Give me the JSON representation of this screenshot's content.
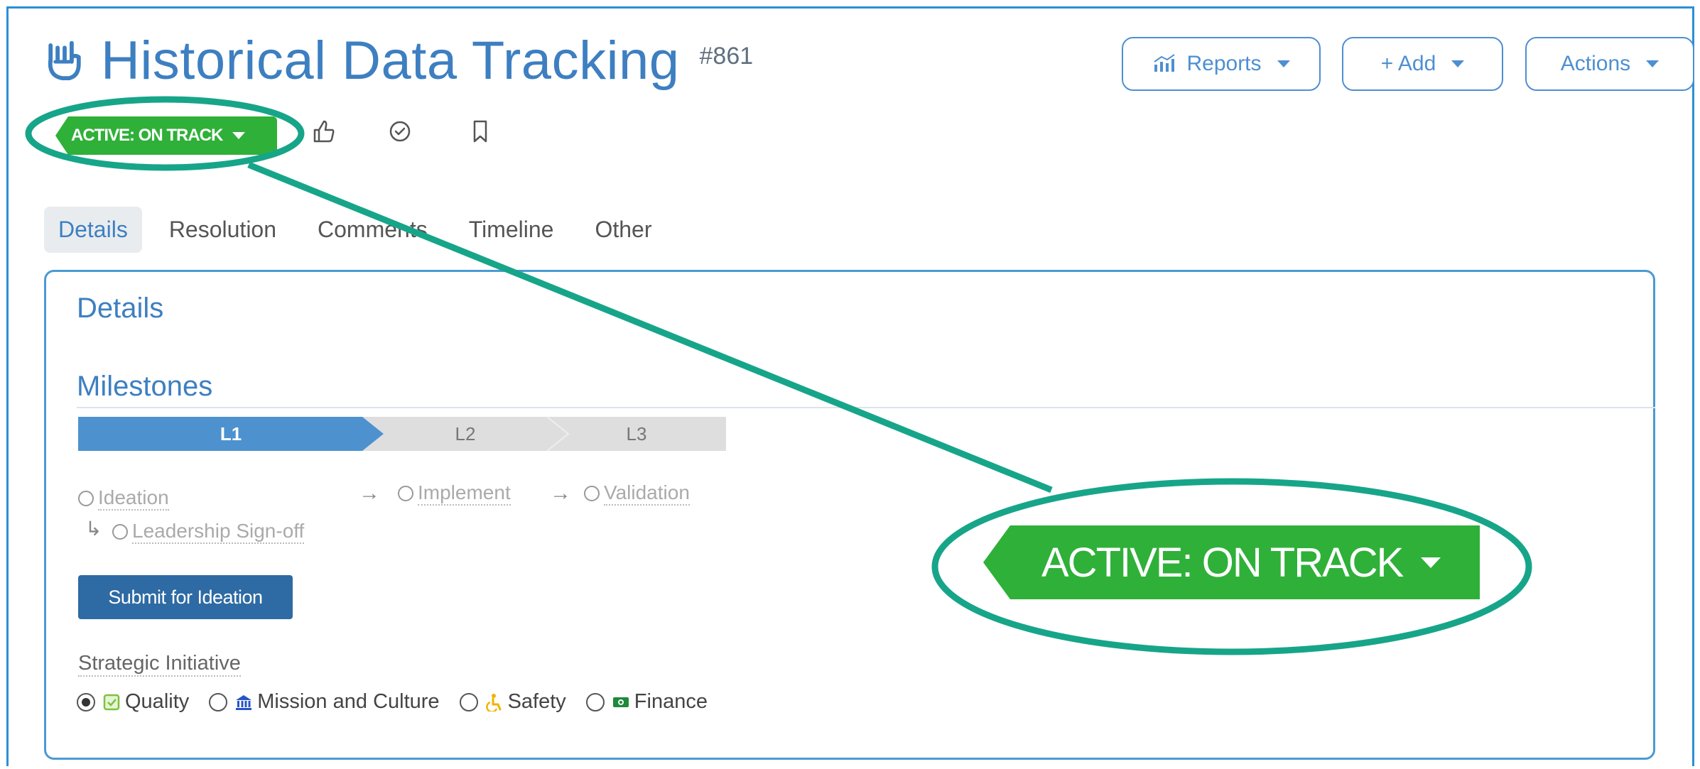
{
  "header": {
    "title": "Historical Data Tracking",
    "id": "#861",
    "buttons": {
      "reports": "Reports",
      "add": "+ Add",
      "actions": "Actions"
    }
  },
  "status": {
    "label": "ACTIVE: ON TRACK",
    "color": "#2fb039"
  },
  "tabs": [
    "Details",
    "Resolution",
    "Comments",
    "Timeline",
    "Other"
  ],
  "panel": {
    "title": "Details",
    "milestones": {
      "title": "Milestones",
      "steps": [
        "L1",
        "L2",
        "L3"
      ],
      "stages": {
        "ideation": "Ideation",
        "implement": "Implement",
        "validation": "Validation",
        "leadership": "Leadership Sign-off"
      },
      "submit_label": "Submit for Ideation"
    },
    "strategic": {
      "label": "Strategic Initiative",
      "options": [
        "Quality",
        "Mission and Culture",
        "Safety",
        "Finance"
      ],
      "selected": "Quality"
    }
  },
  "colors": {
    "accent": "#3d7fc1",
    "callout": "#17a589",
    "frame": "#2b8fd6"
  }
}
